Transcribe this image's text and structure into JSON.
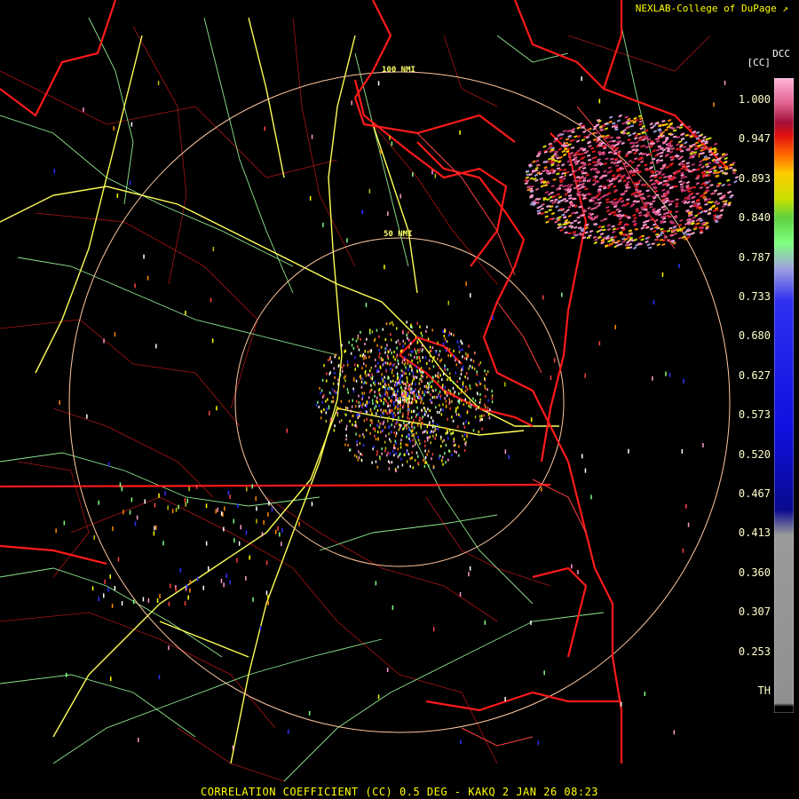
{
  "header": {
    "credit": "NEXLAB-College of DuPage"
  },
  "colorbar": {
    "title_top": "DCC",
    "title_units": "[CC]",
    "labels": [
      "1.000",
      "0.947",
      "0.893",
      "0.840",
      "0.787",
      "0.733",
      "0.680",
      "0.627",
      "0.573",
      "0.520",
      "0.467",
      "0.413",
      "0.360",
      "0.307",
      "0.253",
      "TH"
    ]
  },
  "range_rings": {
    "inner": "50 NMI",
    "outer": "100 NMI"
  },
  "footer": {
    "caption": "CORRELATION COEFFICIENT (CC) 0.5 DEG - KAKQ 2 JAN 26 08:23"
  },
  "colors": {
    "background": "#000000",
    "state_borders": "#ff1111",
    "county_borders": "#b01515",
    "highways": "#ffff55",
    "roads": "#99ff99",
    "rings": "#ffc8a0"
  }
}
